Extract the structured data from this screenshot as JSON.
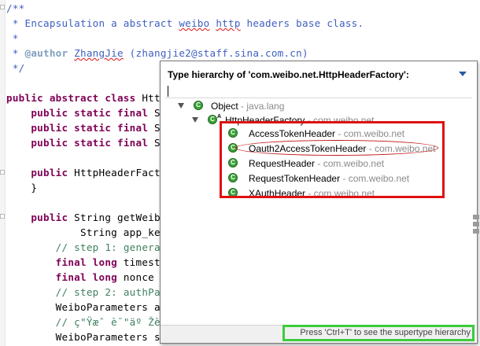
{
  "editor": {
    "lines": [
      {
        "html": "<span class=\"cm\">/**</span>"
      },
      {
        "html": "<span class=\"cm\"> * Encapsulation a abstract <span class=\"sq\">weibo</span> <span class=\"sq\">http</span> headers base class.</span>"
      },
      {
        "html": "<span class=\"cm\"> *</span>"
      },
      {
        "html": "<span class=\"cm\"> * <span class=\"tag\">@author</span> <span class=\"sq\">ZhangJie</span> (zhangjie2@staff.sina.com.cn)</span>"
      },
      {
        "html": "<span class=\"cm\"> */</span>"
      },
      {
        "html": ""
      },
      {
        "html": "<span class=\"kw\">public abstract class</span> Htt"
      },
      {
        "html": "    <span class=\"kw\">public static final</span> S"
      },
      {
        "html": "    <span class=\"kw\">public static final</span> S"
      },
      {
        "html": "    <span class=\"kw\">public static final</span> S"
      },
      {
        "html": ""
      },
      {
        "html": "    <span class=\"kw\">public</span> HttpHeaderFact"
      },
      {
        "html": "    }"
      },
      {
        "html": ""
      },
      {
        "html": "    <span class=\"kw\">public</span> String getWeib"
      },
      {
        "html": "            String app_ke"
      },
      {
        "html": "        <span class=\"sl\">// step 1: genera</span>"
      },
      {
        "html": "        <span class=\"kw\">final long</span> timest"
      },
      {
        "html": "        <span class=\"kw\">final long</span> nonce "
      },
      {
        "html": "        <span class=\"sl\">// step 2: authPa</span>"
      },
      {
        "html": "        WeiboParameters a"
      },
      {
        "html": "        <span class=\"sl\">// ç\"Ÿæˆ è¯\"äº Žè®</span>"
      },
      {
        "html": "        WeiboParameters s"
      }
    ]
  },
  "popup": {
    "title": "Type hierarchy of 'com.weibo.net.HttpHeaderFactory':",
    "root": {
      "name": "Object",
      "pkg": "java.lang"
    },
    "parent": {
      "name": "HttpHeaderFactory",
      "pkg": "com.weibo.net",
      "badge": "A"
    },
    "children": [
      {
        "name": "AccessTokenHeader",
        "pkg": "com.weibo.net"
      },
      {
        "name": "Oauth2AccessTokenHeader",
        "pkg": "com.weibo.net"
      },
      {
        "name": "RequestHeader",
        "pkg": "com.weibo.net"
      },
      {
        "name": "RequestTokenHeader",
        "pkg": "com.weibo.net"
      },
      {
        "name": "XAuthHeader",
        "pkg": "com.weibo.net"
      }
    ],
    "sep": " - ",
    "status": "Press 'Ctrl+T' to see the supertype hierarchy"
  },
  "colors": {
    "highlight_box": "#e01010",
    "status_box": "#3dcc3d",
    "class_icon": "#3aa23a"
  }
}
